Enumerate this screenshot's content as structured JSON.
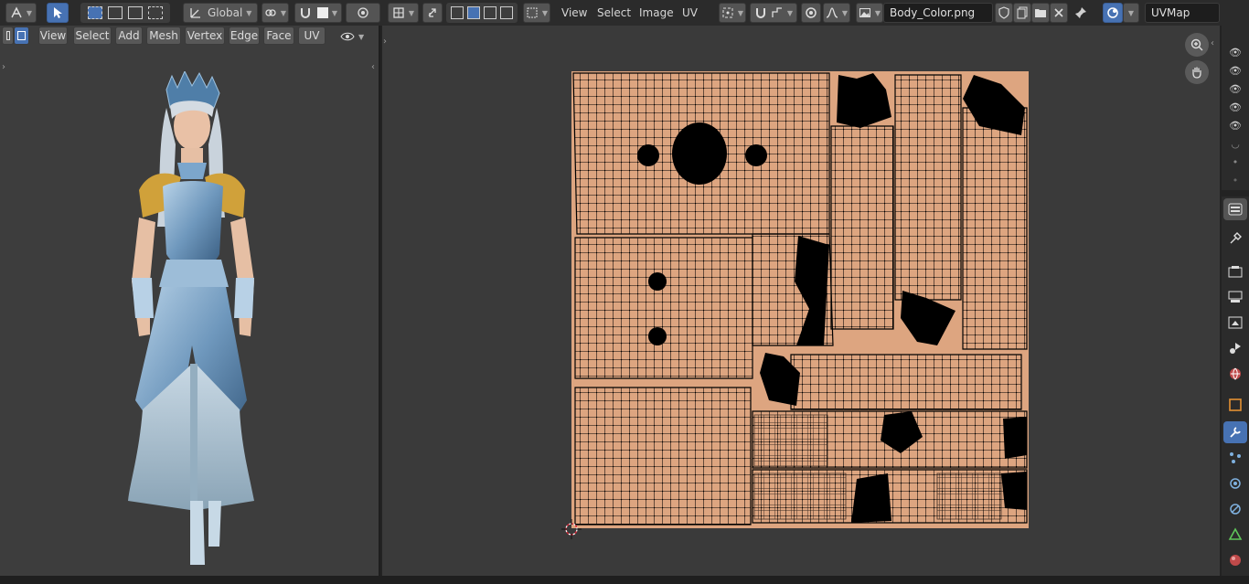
{
  "topbar": {
    "transform_orientation": "Global",
    "uv_menus": [
      "View",
      "Select",
      "Image",
      "UV"
    ],
    "image_name": "Body_Color.png",
    "uv_map_name": "UVMap"
  },
  "viewport": {
    "menus": [
      "View",
      "Select",
      "Add",
      "Mesh",
      "Vertex",
      "Edge",
      "Face",
      "UV"
    ]
  },
  "colors": {
    "accent": "#4772b3",
    "uv_background": "#dda580",
    "panel_bg": "#3a3a3a",
    "header_bg": "#2b2b2b"
  },
  "icons": {
    "editor_type": "editor-type-icon",
    "select_box": "select-box-icon",
    "snap": "magnet-icon",
    "proportional": "proportional-edit-icon",
    "image_browse": "image-icon",
    "new_image": "new-image-icon",
    "open_image": "folder-icon",
    "close_image": "close-icon",
    "pin": "pin-icon",
    "zoom": "zoom-icon",
    "pan": "hand-icon"
  }
}
